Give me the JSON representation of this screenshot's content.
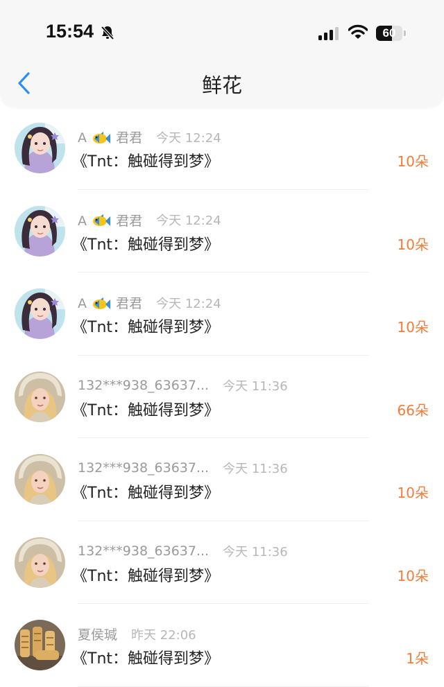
{
  "status_bar": {
    "time": "15:54",
    "battery": "60",
    "battery_level": 0.6
  },
  "nav": {
    "title": "鲜花"
  },
  "records": [
    {
      "name_prefix": "A",
      "name_suffix": "君君",
      "time": "今天 12:24",
      "work": "《Tnt：触碰得到梦》",
      "count": "10朵",
      "avatar": "girl-purple"
    },
    {
      "name_prefix": "A",
      "name_suffix": "君君",
      "time": "今天 12:24",
      "work": "《Tnt：触碰得到梦》",
      "count": "10朵",
      "avatar": "girl-purple"
    },
    {
      "name_prefix": "A",
      "name_suffix": "君君",
      "time": "今天 12:24",
      "work": "《Tnt：触碰得到梦》",
      "count": "10朵",
      "avatar": "girl-purple"
    },
    {
      "name": "132***938_63637...",
      "time": "今天 11:36",
      "work": "《Tnt：触碰得到梦》",
      "count": "66朵",
      "avatar": "blonde-girl"
    },
    {
      "name": "132***938_63637...",
      "time": "今天 11:36",
      "work": "《Tnt：触碰得到梦》",
      "count": "10朵",
      "avatar": "blonde-girl"
    },
    {
      "name": "132***938_63637...",
      "time": "今天 11:36",
      "work": "《Tnt：触碰得到梦》",
      "count": "10朵",
      "avatar": "blonde-girl"
    },
    {
      "name": "夏侯瑊",
      "time": "昨天 22:06",
      "work": "《Tnt：触碰得到梦》",
      "count": "1朵",
      "avatar": "wooden-cylinders"
    }
  ],
  "colors": {
    "accent": "#2f8ff0",
    "count": "#f47c37",
    "muted": "#9a9a9a",
    "header_bg": "#f7f7f8"
  }
}
